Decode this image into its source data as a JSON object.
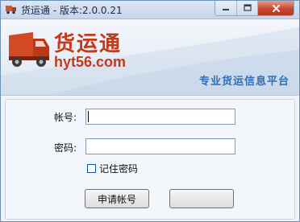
{
  "window": {
    "title": "货运通 - 版本:2.0.0.21"
  },
  "banner": {
    "logo_cn": "货运通",
    "logo_en": "hyt56.com",
    "slogan": "专业货运信息平台"
  },
  "form": {
    "account_label": "帐号:",
    "account_value": "",
    "password_label": "密码:",
    "password_value": "",
    "remember_label": "记住密码",
    "remember_checked": false,
    "register_button": "申请帐号",
    "login_button": ""
  },
  "colors": {
    "brand_red": "#c23a1c",
    "slogan_blue": "#2e6fb5",
    "close_red": "#c8462c"
  }
}
